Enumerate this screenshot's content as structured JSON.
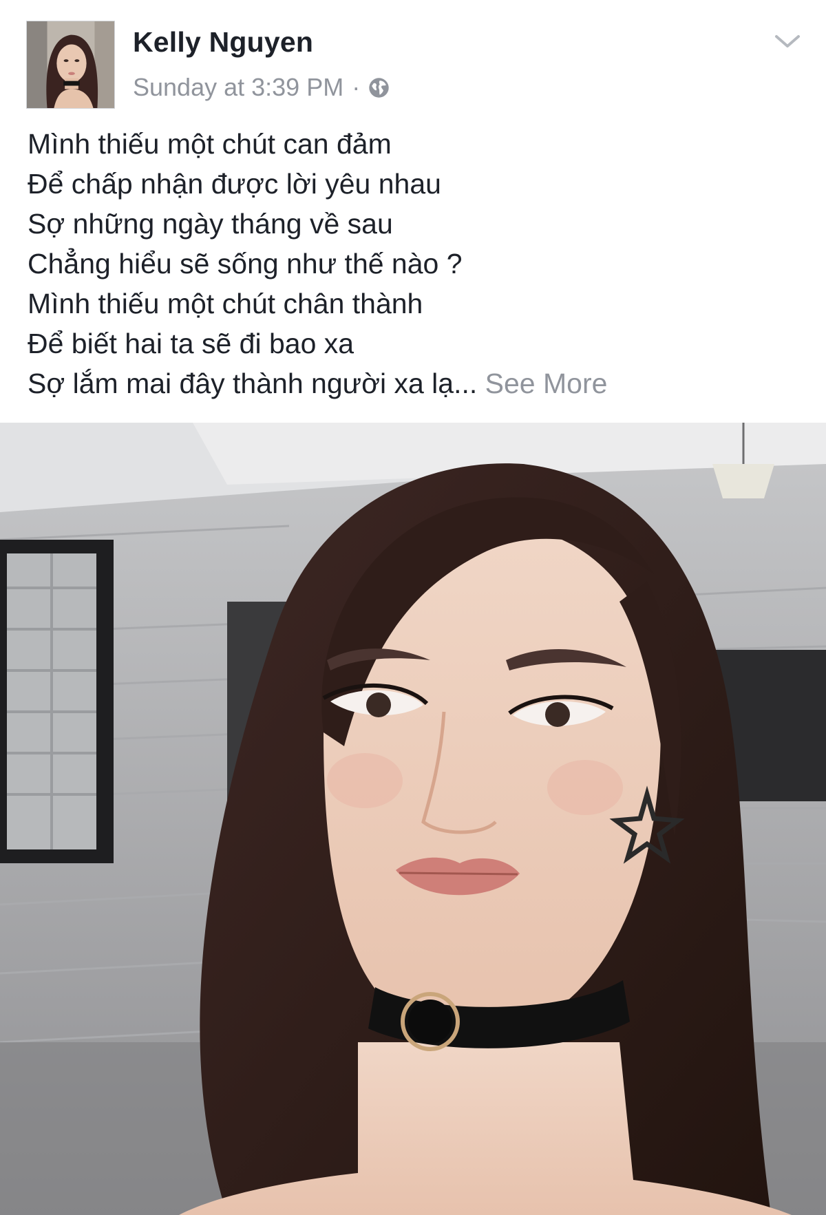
{
  "post": {
    "author": "Kelly Nguyen",
    "timestamp": "Sunday at 3:39 PM",
    "separator": "·",
    "privacy_icon": "globe-icon",
    "menu_icon": "chevron-down-icon",
    "text_lines": [
      "Mình thiếu một chút can đảm",
      "Để chấp nhận được lời yêu nhau",
      "Sợ những ngày tháng về sau",
      "Chẳng hiểu sẽ sống như thế nào ?",
      "Mình thiếu một chút chân thành",
      "Để biết hai ta sẽ đi bao xa",
      "Sợ lắm mai đây thành người xa lạ..."
    ],
    "see_more": "See More",
    "colors": {
      "name": "#1d2129",
      "meta": "#90949c",
      "text": "#1d2129"
    }
  }
}
